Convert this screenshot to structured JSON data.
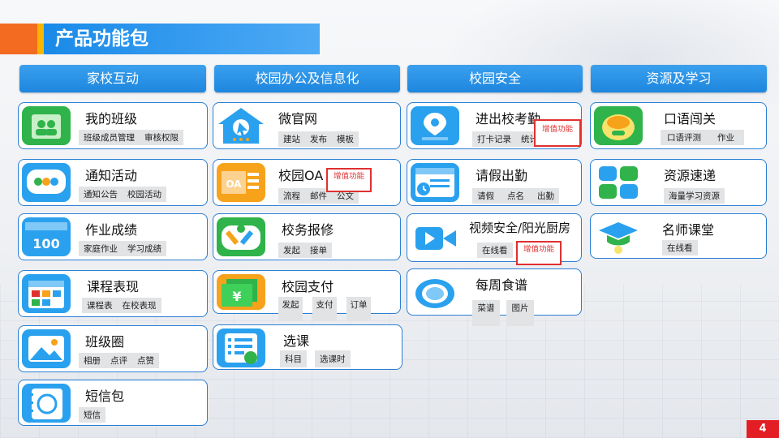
{
  "page_title": "产品功能包",
  "page_number": "4",
  "columns": [
    {
      "header": "家校互动"
    },
    {
      "header": "校园办公及信息化"
    },
    {
      "header": "校园安全"
    },
    {
      "header": "资源及学习"
    }
  ],
  "addon_label": "增值功能",
  "cards": {
    "my_class": {
      "title": "我的班级",
      "tags": [
        "班级成员管理",
        "审核权限"
      ]
    },
    "notice": {
      "title": "通知活动",
      "tags": [
        "通知公告",
        "校园活动"
      ]
    },
    "homework": {
      "title": "作业成绩",
      "tags": [
        "家庭作业",
        "学习成绩"
      ]
    },
    "course": {
      "title": "课程表现",
      "tags": [
        "课程表",
        "在校表现"
      ]
    },
    "circle": {
      "title": "班级圈",
      "tags": [
        "相册",
        "点评",
        "点赞"
      ]
    },
    "sms": {
      "title": "短信包",
      "tags": [
        "短信"
      ]
    },
    "website": {
      "title": "微官网",
      "tags": [
        "建站",
        "发布",
        "模板"
      ]
    },
    "oa": {
      "title": "校园OA",
      "tags": [
        "流程",
        "邮件",
        "公文"
      ]
    },
    "repair": {
      "title": "校务报修",
      "tags": [
        "发起",
        "接单"
      ]
    },
    "pay": {
      "title": "校园支付",
      "tags": [
        "发起",
        "支付",
        "订单"
      ]
    },
    "select": {
      "title": "选课",
      "tags": [
        "科目",
        "选课时"
      ]
    },
    "attendance": {
      "title": "进出校考勤",
      "tags": [
        "打卡记录",
        "统计"
      ]
    },
    "leave": {
      "title": "请假出勤",
      "tags": [
        "请假",
        "点名",
        "出勤"
      ]
    },
    "video": {
      "title": "视频安全/阳光厨房",
      "tags": [
        "在线看"
      ]
    },
    "menu": {
      "title": "每周食谱",
      "tags": [
        "菜谱",
        "图片"
      ]
    },
    "oral": {
      "title": "口语闯关",
      "tags": [
        "口语评测",
        "作业"
      ]
    },
    "resource": {
      "title": "资源速递",
      "tags": [
        "海量学习资源"
      ]
    },
    "teacher": {
      "title": "名师课堂",
      "tags": [
        "在线看"
      ]
    }
  },
  "icon_colors": {
    "blue": "#2aa1ee",
    "green": "#2fb34a",
    "orange": "#f7a21b",
    "red": "#e03030"
  }
}
